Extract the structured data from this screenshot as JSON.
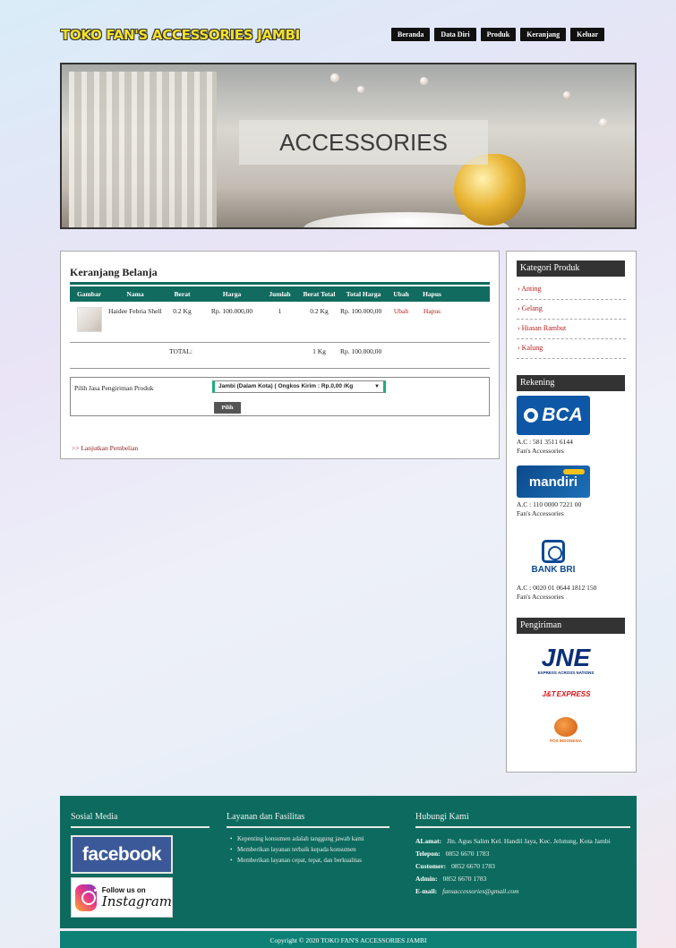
{
  "header": {
    "logo": "TOKO FAN'S ACCESSORIES JAMBI",
    "nav": [
      "Beranda",
      "Data Diri",
      "Produk",
      "Keranjang",
      "Keluar"
    ]
  },
  "banner": {
    "title": "ACCESSORIES"
  },
  "cart": {
    "title": "Keranjang Belanja",
    "columns": [
      "Gambar",
      "Nama",
      "Berat",
      "Harga",
      "Jumlah",
      "Berat Total",
      "Total Harga",
      "Ubah",
      "Hapus"
    ],
    "items": [
      {
        "name": "Haidee Febria Shell",
        "weight": "0.2 Kg",
        "price": "Rp. 100.000,00",
        "qty": "1",
        "total_weight": "0.2 Kg",
        "total_price": "Rp. 100.000,00",
        "edit": "Ubah",
        "delete": "Hapus"
      }
    ],
    "total_label": "TOTAL:",
    "total_weight": "1 Kg",
    "total_price": "Rp. 100.000,00",
    "shipping_label": "Pilih Jasa Pengiriman Produk",
    "shipping_selected": "Jambi (Dalam Kota) ( Ongkos Kirim : Rp.0,00 /Kg",
    "choose_button": "Pilih",
    "continue_link": ">> Lanjutkan Pembelian"
  },
  "sidebar": {
    "category_title": "Kategori Produk",
    "categories": [
      "Anting",
      "Gelang",
      "Hiasan Rambut",
      "Kalung"
    ],
    "account_title": "Rekening",
    "banks": [
      {
        "logo": "BCA",
        "account": "A.C : 581 3511 6144",
        "holder": "Fan's Accessories"
      },
      {
        "logo": "mandiri",
        "account": "A.C : 110 0000 7221 00",
        "holder": "Fan's Accessories"
      },
      {
        "logo": "BANK BRI",
        "account": "A.C : 0020 01 0644 1812 150",
        "holder": "Fan's Accessories"
      }
    ],
    "shipping_title": "Pengiriman",
    "couriers": {
      "jne": "JNE",
      "jne_tagline": "EXPRESS ACROSS NATIONS",
      "jt": "J&T",
      "jt_suffix": "EXPRESS",
      "pos": "POS INDONESIA"
    }
  },
  "footer": {
    "social_title": "Sosial Media",
    "facebook": "facebook",
    "instagram_top": "Follow us on",
    "instagram_bottom": "Instagram",
    "services_title": "Layanan dan Fasilitas",
    "services": [
      "Kepenting konsumen adalah tanggung jawab kami",
      "Memberikan layanan terbaik kepada konsumen",
      "Memberikan layanan cepat, tepat, dan berkualitas"
    ],
    "contact_title": "Hubungi Kami",
    "contact": {
      "address_label": "ALamat:",
      "address": "Jln. Agus Salim Kel. Handil Jaya, Kec. Jelutung, Kota Jambi",
      "phone_label": "Telepon:",
      "phone": "0852 6670 1783",
      "customer_label": "Customer:",
      "customer": "0852 6670 1783",
      "admin_label": "Admin:",
      "admin": "0852 6670 1783",
      "email_label": "E-mail:",
      "email": "fansaccessories@gmail.com"
    },
    "copyright": "Copyright © 2020 TOKO FAN'S ACCESSORIES JAMBI"
  }
}
